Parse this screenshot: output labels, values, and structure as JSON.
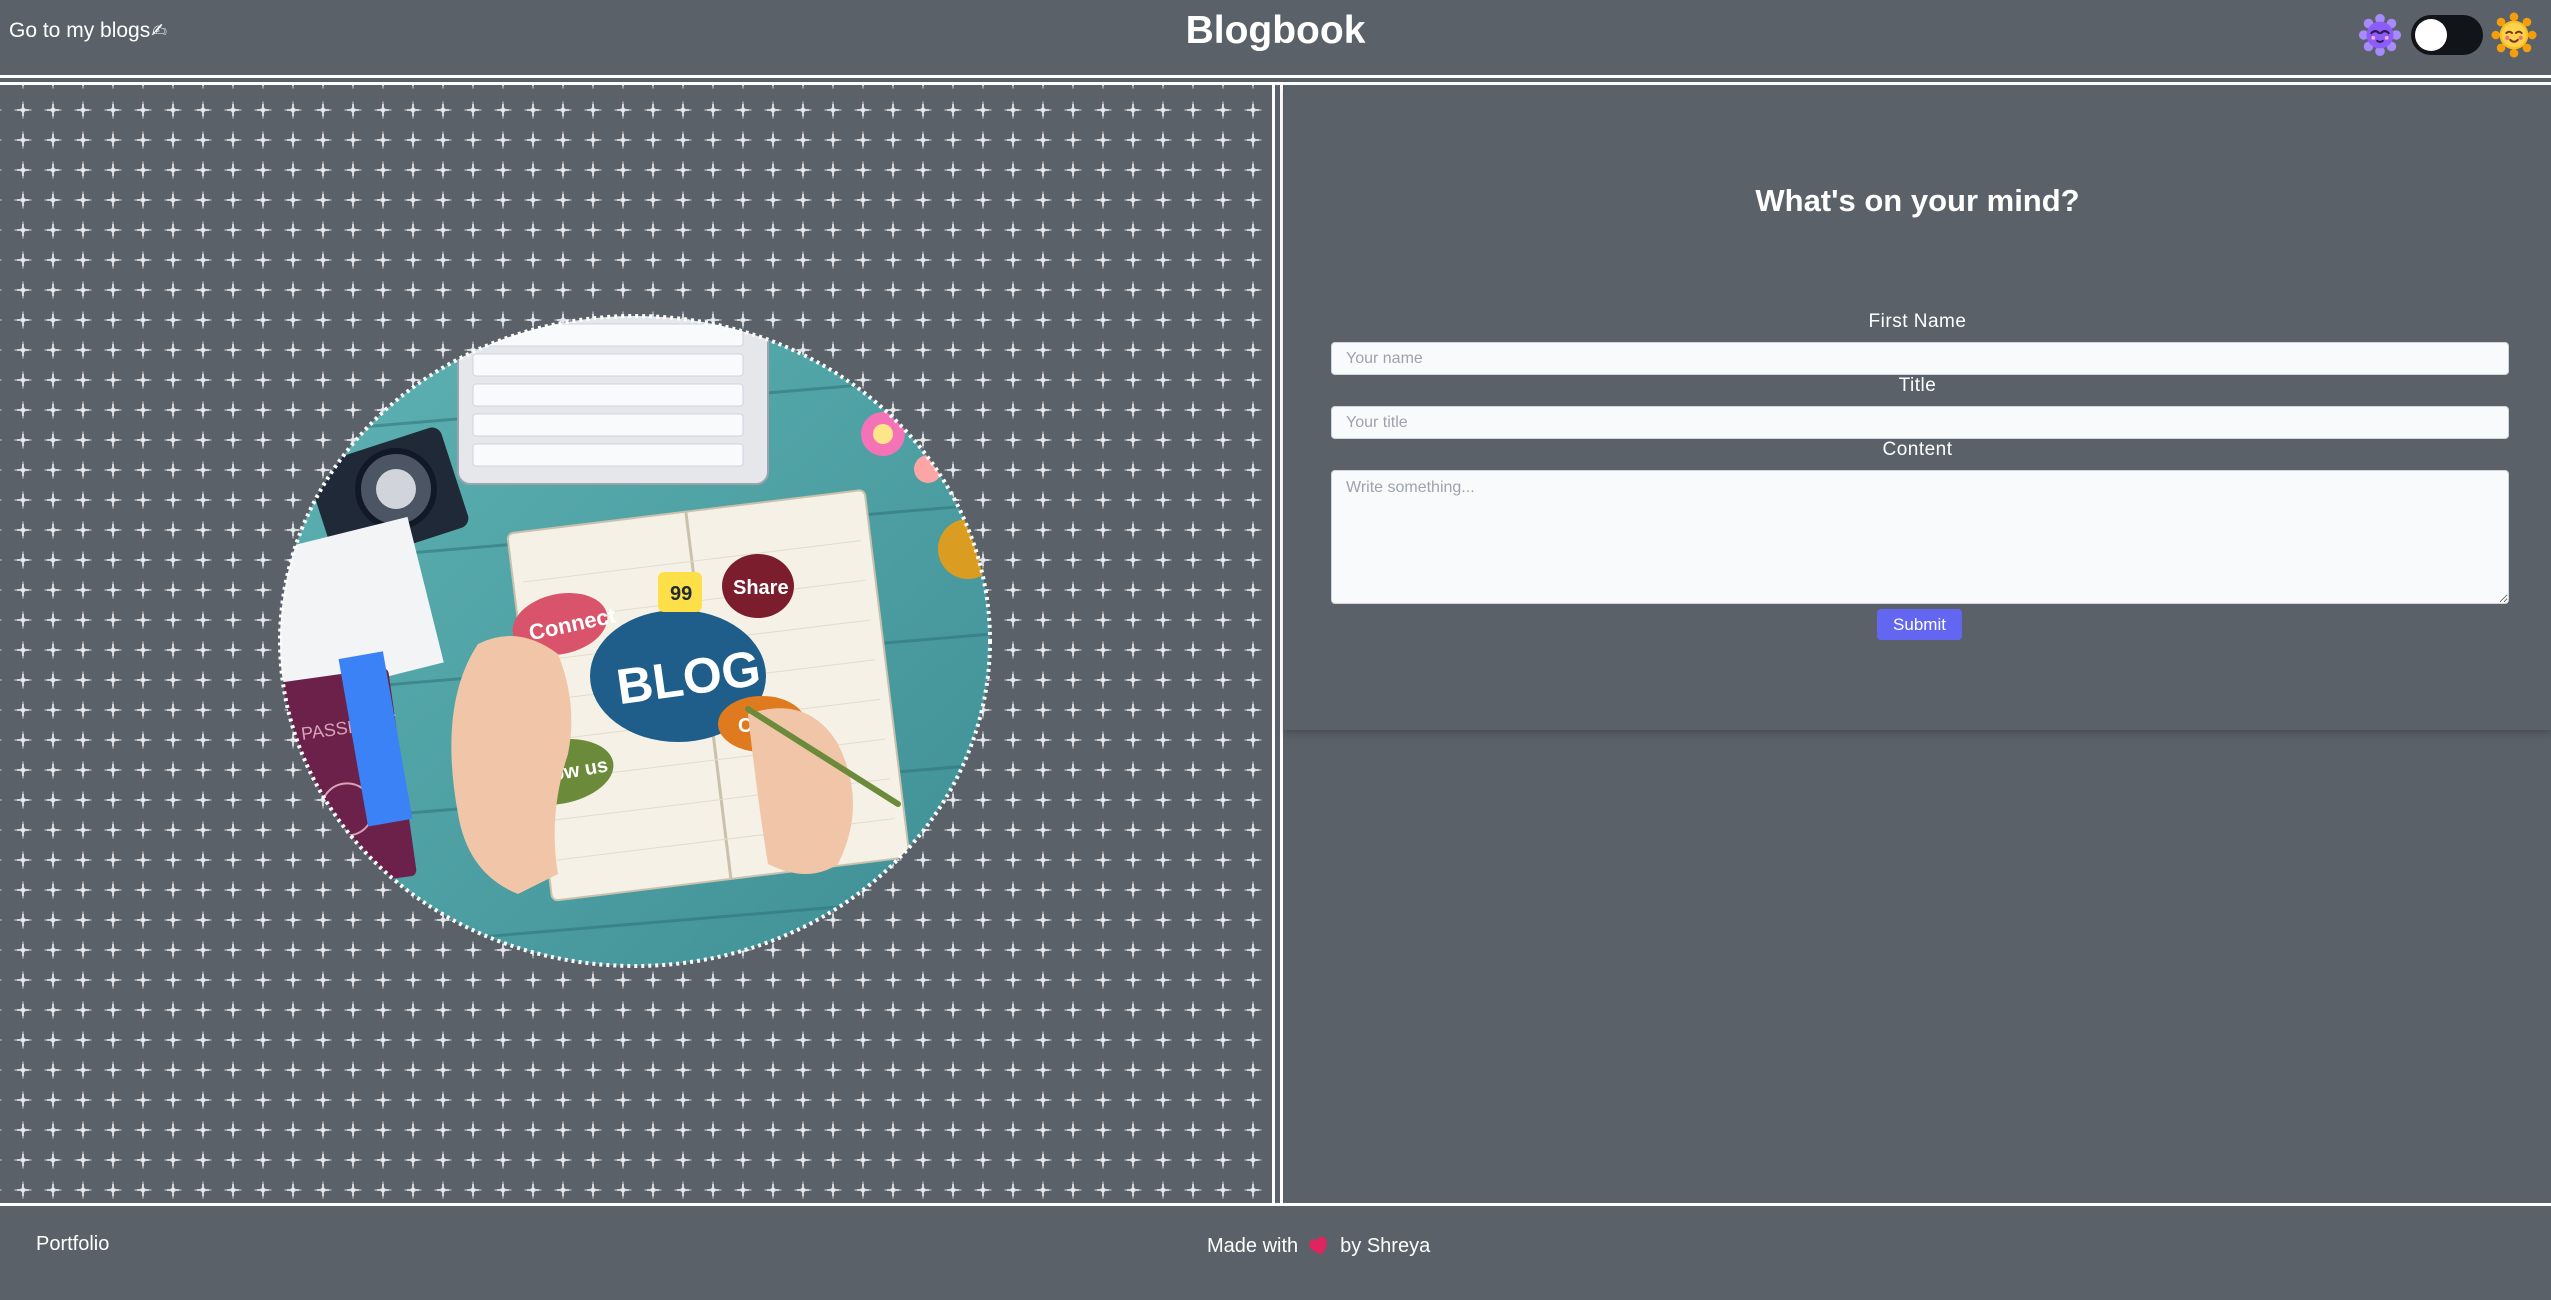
{
  "header": {
    "nav_link_label": "Go to my blogs",
    "nav_link_emoji": "✍",
    "brand_title": "Blogbook",
    "theme_toggle": {
      "state": "off",
      "left_icon": "moon-face-icon",
      "right_icon": "sun-face-icon"
    }
  },
  "hero": {
    "illustration_icon": "blog-illustration",
    "illustration_words": [
      "Connect",
      "Share",
      "BLOG",
      "Follow us",
      "Con",
      "PASSPORT"
    ]
  },
  "form": {
    "heading": "What's on your mind?",
    "fields": {
      "name": {
        "label": "First Name",
        "placeholder": "Your name",
        "value": ""
      },
      "title": {
        "label": "Title",
        "placeholder": "Your title",
        "value": ""
      },
      "content": {
        "label": "Content",
        "placeholder": "Write something...",
        "value": ""
      }
    },
    "submit_label": "Submit"
  },
  "footer": {
    "portfolio_label": "Portfolio",
    "made_with_label": "Made with",
    "heart_icon": "heart-icon",
    "by_label": "by Shreya"
  },
  "colors": {
    "background": "#5b6168",
    "accent": "#6366f1",
    "rule": "#ffffff",
    "input_background": "#f9fafb",
    "heart": "#e0245e"
  }
}
